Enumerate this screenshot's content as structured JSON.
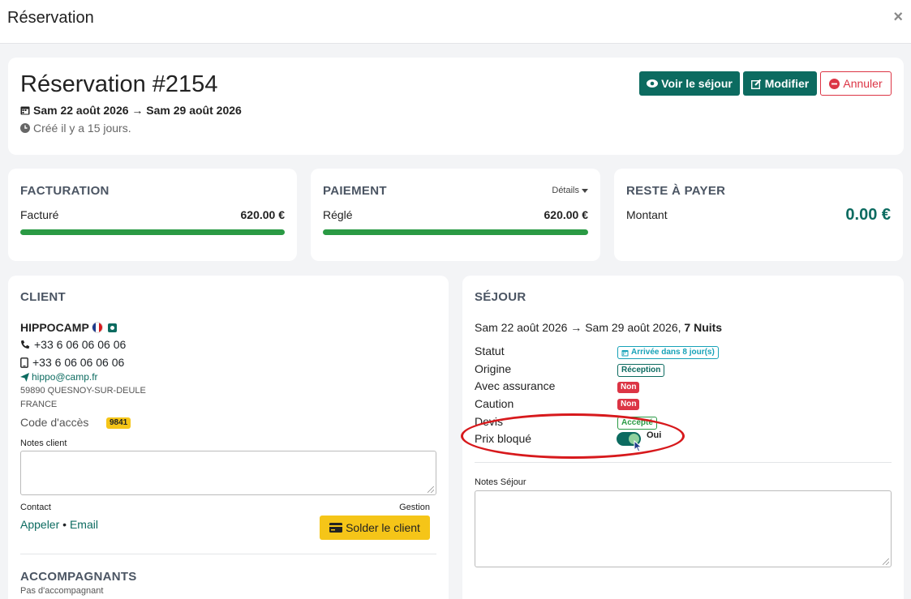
{
  "modal": {
    "title": "Réservation",
    "close": "×"
  },
  "header": {
    "title": "Réservation #2154",
    "dates": "Sam 22 août 2026 → Sam 29 août 2026",
    "created": "Créé il y a 15 jours.",
    "buttons": {
      "view": "Voir le séjour",
      "edit": "Modifier",
      "cancel": "Annuler"
    }
  },
  "billing": {
    "title": "FACTURATION",
    "label": "Facturé",
    "amount": "620.00 €",
    "progress": 1.0
  },
  "payment": {
    "title": "PAIEMENT",
    "details": "Détails",
    "label": "Réglé",
    "amount": "620.00 €",
    "progress": 1.0
  },
  "remaining": {
    "title": "RESTE À PAYER",
    "label": "Montant",
    "amount": "0.00 €"
  },
  "client": {
    "title": "CLIENT",
    "name": "HIPPOCAMP",
    "phone": "+33 6 06 06 06 06",
    "mobile": "+33 6 06 06 06 06",
    "email": "hippo@camp.fr",
    "address": "59890 QUESNOY-SUR-DEULE",
    "country": "FRANCE",
    "access_label": "Code d'accès",
    "access_code": "9841",
    "notes_label": "Notes client",
    "contact_label": "Contact",
    "gestion_label": "Gestion",
    "call": "Appeler",
    "dot": "•",
    "email_link": "Email",
    "settle": "Solder le client",
    "companions_title": "ACCOMPAGNANTS",
    "no_companion": "Pas d'accompagnant"
  },
  "stay": {
    "title": "SÉJOUR",
    "dates": "Sam 22 août 2026 → Sam 29 août 2026,",
    "nights": "7 Nuits",
    "rows": [
      {
        "label": "Statut",
        "value": "Arrivée dans 8 jour(s)"
      },
      {
        "label": "Origine",
        "value": "Réception"
      },
      {
        "label": "Avec assurance",
        "value": "Non"
      },
      {
        "label": "Caution",
        "value": "Non"
      },
      {
        "label": "Devis",
        "value": "Accepté"
      },
      {
        "label": "Prix bloqué",
        "value": "Oui"
      }
    ],
    "price_locked": true,
    "notes_label": "Notes Séjour"
  },
  "colors": {
    "accent": "#0c6b60",
    "danger": "#dc3545",
    "success": "#2a9a44",
    "warning": "#f5c518",
    "highlight": "#d7191c"
  }
}
